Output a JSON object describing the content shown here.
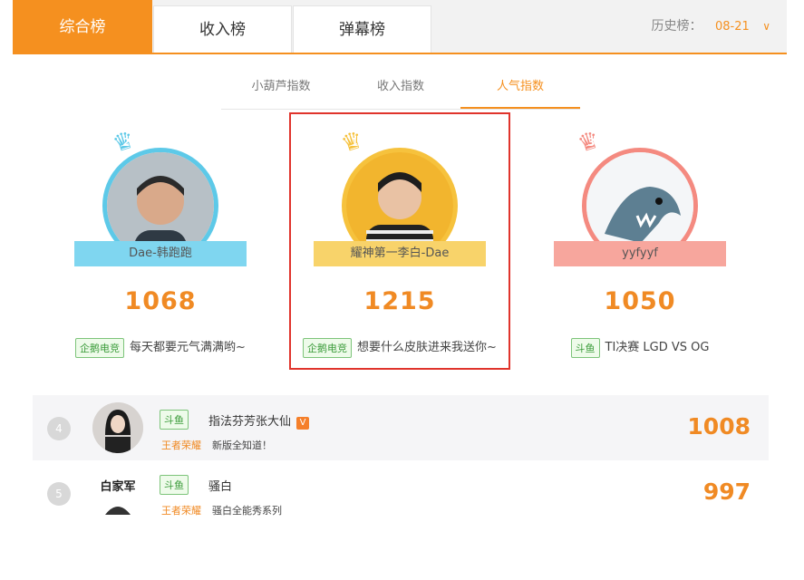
{
  "tabs": [
    "综合榜",
    "收入榜",
    "弹幕榜"
  ],
  "history": {
    "label": "历史榜：",
    "date": "08-21",
    "chevron_icon": "chevron-down-icon"
  },
  "subtabs": [
    "小葫芦指数",
    "收入指数",
    "人气指数"
  ],
  "podium": [
    {
      "rank": "2",
      "name": "Dae-韩跑跑",
      "score": "1068",
      "platform": "企鹅电竞",
      "desc": "每天都要元气满满哟~",
      "color": "#5dc9e8"
    },
    {
      "rank": "1",
      "name": "耀神第一李白-Dae",
      "score": "1215",
      "platform": "企鹅电竞",
      "desc": "想要什么皮肤进来我送你~",
      "color": "#f6c23d"
    },
    {
      "rank": "3",
      "name": "yyfyyf",
      "score": "1050",
      "platform": "斗鱼",
      "desc": "TI决赛 LGD VS OG",
      "color": "#f48a80"
    }
  ],
  "list": [
    {
      "rank": "4",
      "platform": "斗鱼",
      "name": "指法芬芳张大仙",
      "badge": "V",
      "game": "王者荣耀",
      "desc": "新版全知道！",
      "score": "1008"
    },
    {
      "rank": "5",
      "platform": "斗鱼",
      "name": "骚白",
      "game": "王者荣耀",
      "desc": "骚白全能秀系列",
      "score": "997",
      "avatar_text": "白家军"
    }
  ]
}
